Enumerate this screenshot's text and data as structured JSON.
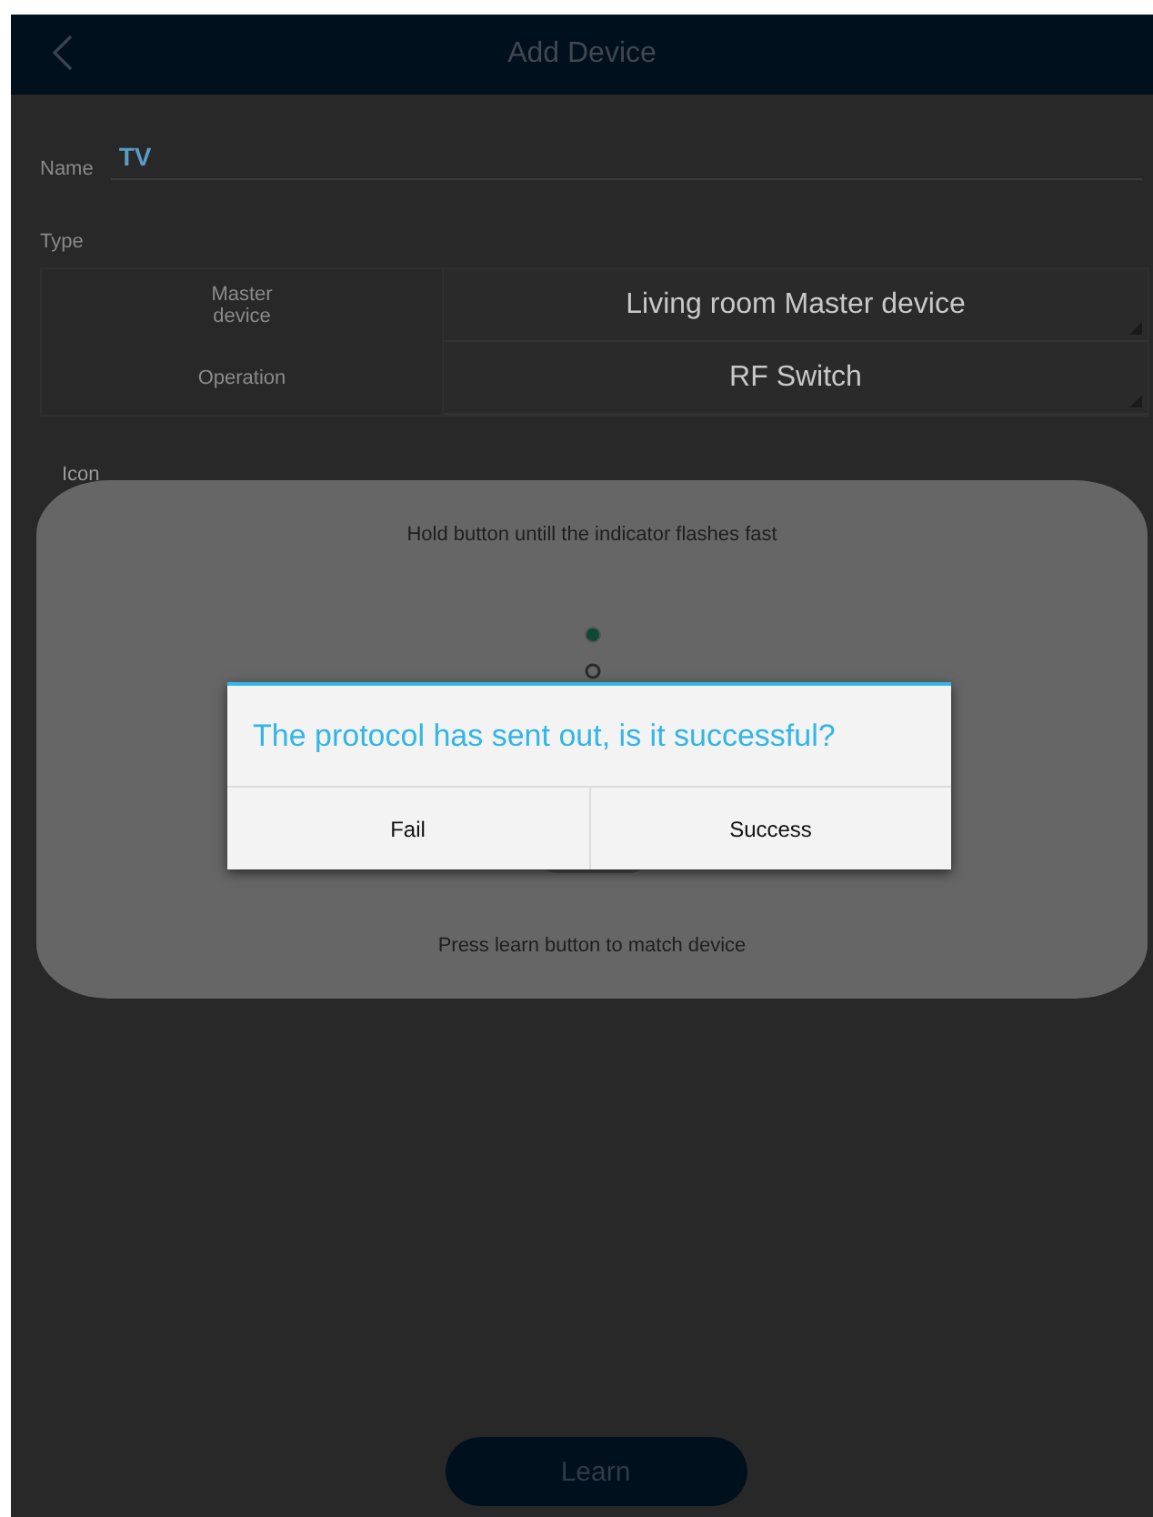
{
  "header": {
    "title": "Add Device"
  },
  "name_field": {
    "label": "Name",
    "value": "TV"
  },
  "type_section": {
    "label": "Type",
    "rows": [
      {
        "label": "Master device",
        "value": "Living room Master device"
      },
      {
        "label": "Operation",
        "value": "RF Switch"
      }
    ]
  },
  "icon_section": {
    "label": "Icon"
  },
  "learn_panel": {
    "hint": "Hold button untill the indicator flashes fast",
    "footer": "Press learn button to match device"
  },
  "dialog": {
    "message": "The protocol has sent out, is it successful?",
    "buttons": [
      "Fail",
      "Success"
    ]
  },
  "learn_button": {
    "label": "Learn"
  }
}
